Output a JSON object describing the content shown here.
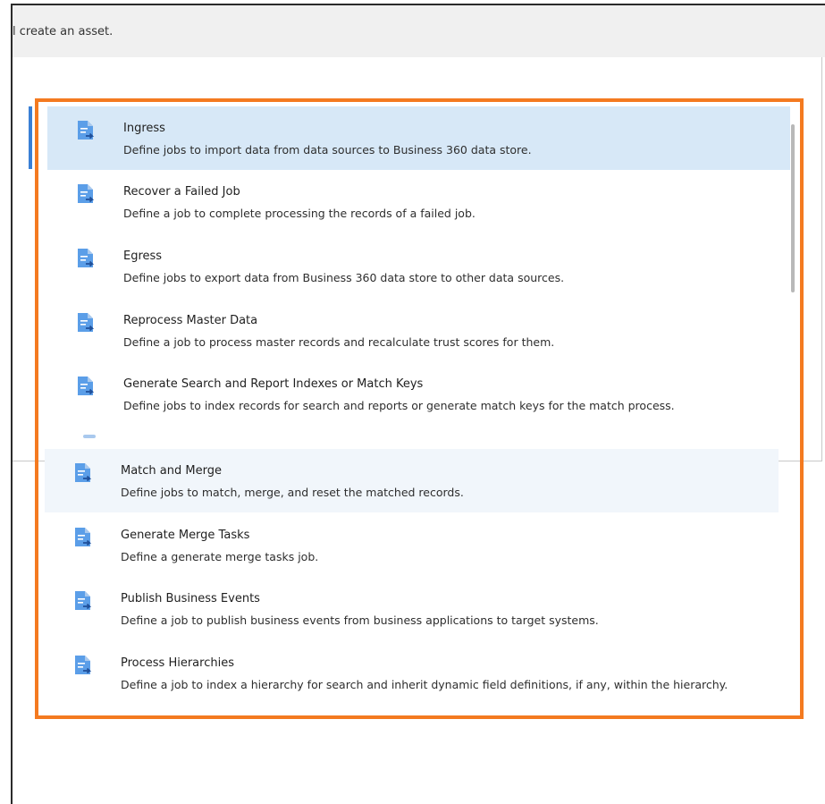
{
  "background_bar": {
    "text": "l create an asset."
  },
  "colors": {
    "highlight_border": "#f47a20",
    "selected_bg": "#d7e8f7",
    "icon_blue": "#5b9ee8",
    "accent": "#3a7fd5"
  },
  "icons": {
    "item_icon": "document-arrow-icon"
  },
  "asset_list": {
    "items": [
      {
        "title": "Ingress",
        "description": "Define jobs to import data from data sources to Business 360 data store."
      },
      {
        "title": "Recover a Failed Job",
        "description": "Define a job to complete processing the records of a failed job."
      },
      {
        "title": "Egress",
        "description": "Define jobs to export data from Business 360 data store to other data sources."
      },
      {
        "title": "Reprocess Master Data",
        "description": "Define a job to process master records and recalculate trust scores for them."
      },
      {
        "title": "Generate Search and Report Indexes or Match Keys",
        "description": "Define jobs to index records for search and reports or generate match keys for the match process."
      },
      {
        "title": "Match and Merge",
        "description": "Define jobs to match, merge, and reset the matched records."
      },
      {
        "title": "Generate Merge Tasks",
        "description": "Define a generate merge tasks job."
      },
      {
        "title": "Publish Business Events",
        "description": "Define a job to publish business events from business applications to target systems."
      },
      {
        "title": "Process Hierarchies",
        "description": "Define a job to index a hierarchy for search and inherit dynamic field definitions, if any, within the hierarchy."
      }
    ]
  }
}
